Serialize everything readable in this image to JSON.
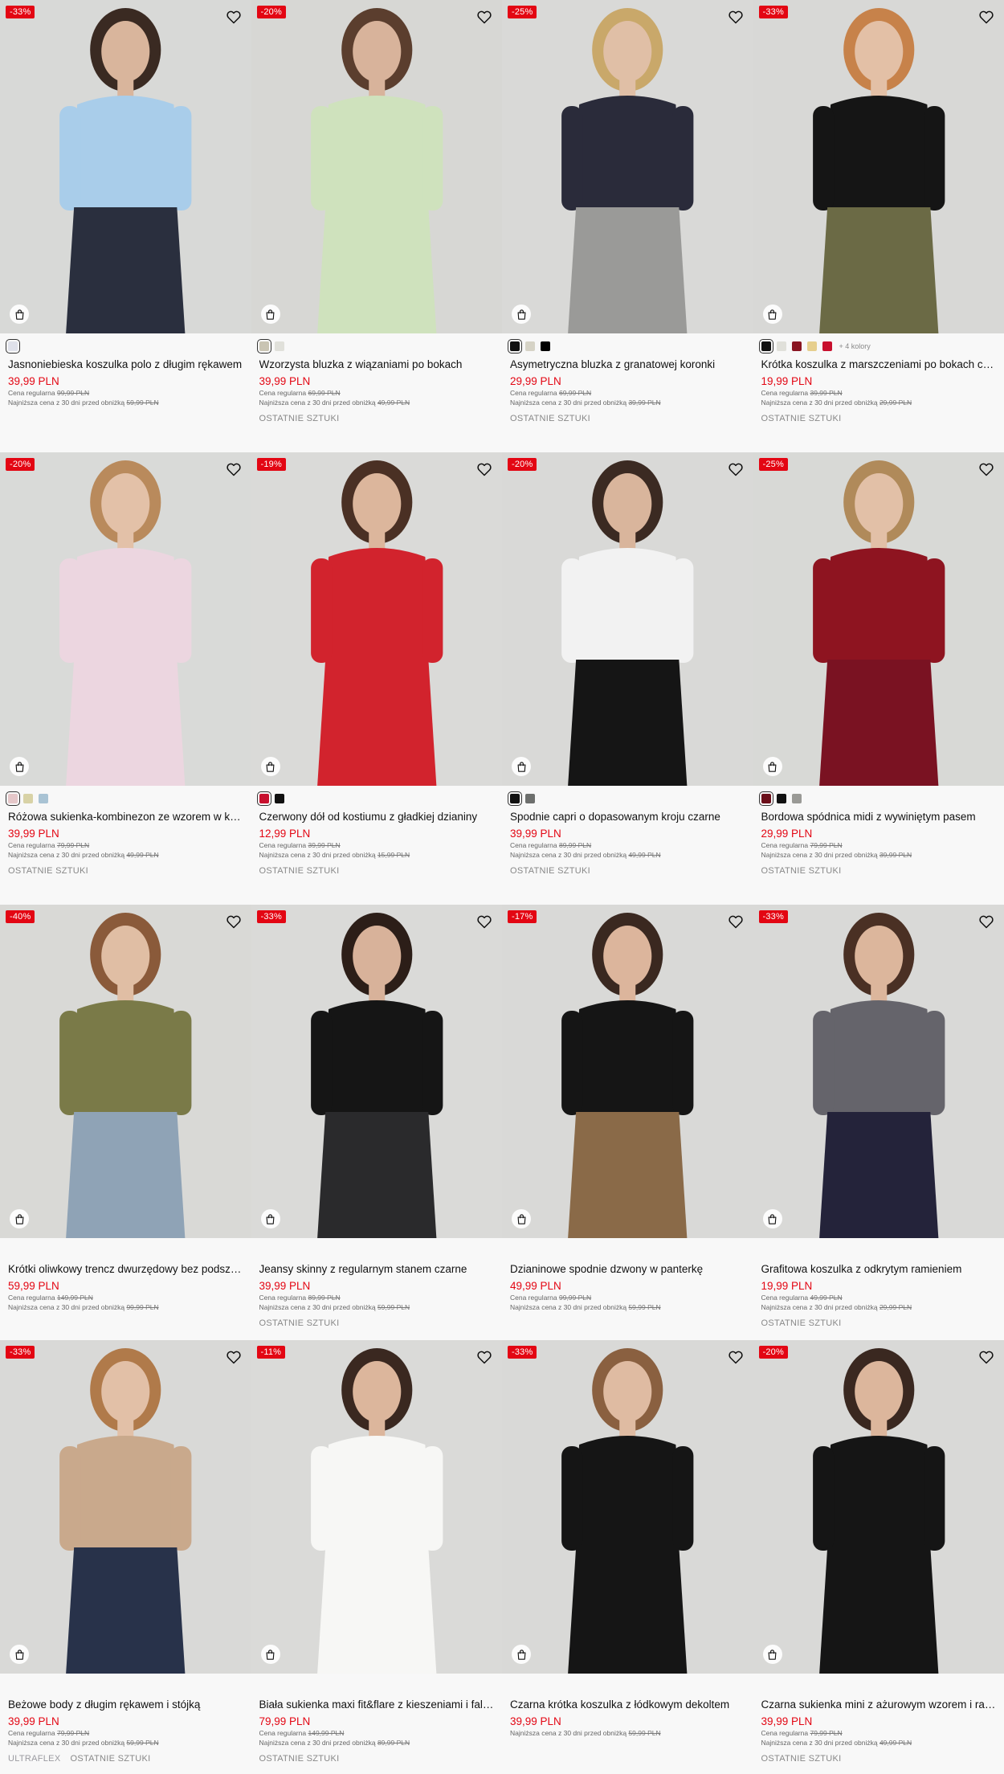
{
  "labels": {
    "regular_price": "Cena regularna",
    "lowest_30": "Najniższa cena z 30 dni przed obniżką"
  },
  "products": [
    {
      "discount": "-33%",
      "swatches": [
        "#dfe1ea"
      ],
      "selected": 0,
      "more_colors": "",
      "title": "Jasnoniebieska koszulka polo z długim rękawem",
      "price": "39,99 PLN",
      "regular": "99,99 PLN",
      "lowest": "59,99 PLN",
      "tags": [],
      "scene": {
        "bg": "#d8d9d7",
        "top": "#a9cdea",
        "bottom": "#2a2f3e",
        "hair": "#3a2a22",
        "skin": "#d9b59c"
      }
    },
    {
      "discount": "-20%",
      "swatches": [
        "#c9c4b3",
        "#e0e0da"
      ],
      "selected": 0,
      "more_colors": "",
      "title": "Wzorzysta bluzka z wiązaniami po bokach",
      "price": "39,99 PLN",
      "regular": "69,99 PLN",
      "lowest": "49,99 PLN",
      "tags": [
        "OSTATNIE SZTUKI"
      ],
      "scene": {
        "bg": "#d7d7d4",
        "top": "#cfe2bd",
        "bottom": "#cfe2bd",
        "hair": "#5b3e2e",
        "skin": "#d8b39b"
      }
    },
    {
      "discount": "-25%",
      "swatches": [
        "#111111",
        "#d6d3c6",
        "#000000"
      ],
      "selected": 0,
      "more_colors": "",
      "title": "Asymetryczna bluzka z granatowej koronki",
      "price": "29,99 PLN",
      "regular": "69,99 PLN",
      "lowest": "39,99 PLN",
      "tags": [
        "OSTATNIE SZTUKI"
      ],
      "scene": {
        "bg": "#d9d9d7",
        "top": "#2a2b3a",
        "bottom": "#9a9a98",
        "hair": "#c9a86a",
        "skin": "#e0bfa6"
      }
    },
    {
      "discount": "-33%",
      "swatches": [
        "#111111",
        "#e0e0da",
        "#8a1522",
        "#e6cf8e",
        "#c8102e"
      ],
      "selected": 0,
      "more_colors": "+ 4 kolory",
      "title": "Krótka koszulka z marszczeniami po bokach czarna",
      "price": "19,99 PLN",
      "regular": "39,99 PLN",
      "lowest": "29,99 PLN",
      "tags": [
        "OSTATNIE SZTUKI"
      ],
      "scene": {
        "bg": "#d8d8d6",
        "top": "#151515",
        "bottom": "#6b6a45",
        "hair": "#c7824a",
        "skin": "#e3c0a6"
      }
    },
    {
      "discount": "-20%",
      "swatches": [
        "#e5c7c9",
        "#d8d2a6",
        "#a9c3d4"
      ],
      "selected": 0,
      "more_colors": "",
      "title": "Różowa sukienka-kombinezon ze wzorem w kwiaty",
      "price": "39,99 PLN",
      "regular": "79,99 PLN",
      "lowest": "49,99 PLN",
      "tags": [
        "OSTATNIE SZTUKI"
      ],
      "scene": {
        "bg": "#d9dad8",
        "top": "#ecd6e0",
        "bottom": "#ecd6e0",
        "hair": "#b98a5c",
        "skin": "#e3c1a8"
      }
    },
    {
      "discount": "-19%",
      "swatches": [
        "#c8102e",
        "#111111"
      ],
      "selected": 0,
      "more_colors": "",
      "title": "Czerwony dół od kostiumu z gładkiej dzianiny",
      "price": "12,99 PLN",
      "regular": "39,99 PLN",
      "lowest": "15,99 PLN",
      "tags": [
        "OSTATNIE SZTUKI"
      ],
      "scene": {
        "bg": "#dadad8",
        "top": "#d2232d",
        "bottom": "#d2232d",
        "hair": "#4a3024",
        "skin": "#dcb69c"
      }
    },
    {
      "discount": "-20%",
      "swatches": [
        "#111111",
        "#6d6f6d"
      ],
      "selected": 0,
      "more_colors": "",
      "title": "Spodnie capri o dopasowanym kroju czarne",
      "price": "39,99 PLN",
      "regular": "89,99 PLN",
      "lowest": "49,99 PLN",
      "tags": [
        "OSTATNIE SZTUKI"
      ],
      "scene": {
        "bg": "#d9d9d7",
        "top": "#f2f2f2",
        "bottom": "#151515",
        "hair": "#3b2a22",
        "skin": "#d9b59c"
      }
    },
    {
      "discount": "-25%",
      "swatches": [
        "#6b0f1a",
        "#111111",
        "#9a9a96"
      ],
      "selected": 0,
      "more_colors": "",
      "title": "Bordowa spódnica midi z wywiniętym pasem",
      "price": "29,99 PLN",
      "regular": "79,99 PLN",
      "lowest": "39,99 PLN",
      "tags": [
        "OSTATNIE SZTUKI"
      ],
      "scene": {
        "bg": "#d8d9d6",
        "top": "#8e1420",
        "bottom": "#7a1222",
        "hair": "#b08a5a",
        "skin": "#e2c0a7"
      }
    },
    {
      "discount": "-40%",
      "swatches": [],
      "selected": -1,
      "more_colors": "",
      "title": "Krótki oliwkowy trencz dwurzędowy bez podszewki",
      "price": "59,99 PLN",
      "regular": "149,99 PLN",
      "lowest": "99,99 PLN",
      "tags": [],
      "scene": {
        "bg": "#d9d9d6",
        "top": "#7a7a48",
        "bottom": "#8fa3b6",
        "hair": "#8a5a3a",
        "skin": "#e0bea4"
      }
    },
    {
      "discount": "-33%",
      "swatches": [],
      "selected": -1,
      "more_colors": "",
      "title": "Jeansy skinny z regularnym stanem czarne",
      "price": "39,99 PLN",
      "regular": "89,99 PLN",
      "lowest": "59,99 PLN",
      "tags": [
        "OSTATNIE SZTUKI"
      ],
      "scene": {
        "bg": "#dadad8",
        "top": "#151515",
        "bottom": "#2a2a2c",
        "hair": "#2c1e18",
        "skin": "#d8b29a"
      }
    },
    {
      "discount": "-17%",
      "swatches": [],
      "selected": -1,
      "more_colors": "",
      "title": "Dzianinowe spodnie dzwony w panterkę",
      "price": "49,99 PLN",
      "regular": "99,99 PLN",
      "lowest": "59,99 PLN",
      "tags": [],
      "scene": {
        "bg": "#d9d9d7",
        "top": "#151515",
        "bottom": "#8a6a48",
        "hair": "#3a2820",
        "skin": "#dcb59c"
      }
    },
    {
      "discount": "-33%",
      "swatches": [],
      "selected": -1,
      "more_colors": "",
      "title": "Grafitowa koszulka z odkrytym ramieniem",
      "price": "19,99 PLN",
      "regular": "49,99 PLN",
      "lowest": "29,99 PLN",
      "tags": [
        "OSTATNIE SZTUKI"
      ],
      "scene": {
        "bg": "#d9d9d7",
        "top": "#65646b",
        "bottom": "#24233a",
        "hair": "#4a3024",
        "skin": "#dcb69c"
      }
    },
    {
      "discount": "-33%",
      "swatches": [],
      "selected": -1,
      "more_colors": "",
      "title": "Beżowe body z długim rękawem i stójką",
      "price": "39,99 PLN",
      "regular": "79,99 PLN",
      "lowest": "59,99 PLN",
      "tags": [
        "ULTRAFLEX",
        "OSTATNIE SZTUKI"
      ],
      "scene": {
        "bg": "#d9d9d7",
        "top": "#c9a98c",
        "bottom": "#28324a",
        "hair": "#b07a4a",
        "skin": "#e2c0a7"
      }
    },
    {
      "discount": "-11%",
      "swatches": [],
      "selected": -1,
      "more_colors": "",
      "title": "Biała sukienka maxi fit&flare z kieszeniami i falbaną",
      "price": "79,99 PLN",
      "regular": "149,99 PLN",
      "lowest": "89,99 PLN",
      "tags": [
        "OSTATNIE SZTUKI"
      ],
      "scene": {
        "bg": "#dadad8",
        "top": "#f7f7f5",
        "bottom": "#f7f7f5",
        "hair": "#3a2820",
        "skin": "#dcb69c"
      }
    },
    {
      "discount": "-33%",
      "swatches": [],
      "selected": -1,
      "more_colors": "",
      "title": "Czarna krótka koszulka z łódkowym dekoltem",
      "price": "39,99 PLN",
      "regular": "",
      "lowest": "59,99 PLN",
      "tags": [],
      "scene": {
        "bg": "#d9d9d7",
        "top": "#151515",
        "bottom": "#151515",
        "hair": "#8a6040",
        "skin": "#dfbba2"
      }
    },
    {
      "discount": "-20%",
      "swatches": [],
      "selected": -1,
      "more_colors": "",
      "title": "Czarna sukienka mini z ażurowym wzorem i ramiączkami",
      "price": "39,99 PLN",
      "regular": "79,99 PLN",
      "lowest": "49,99 PLN",
      "tags": [
        "OSTATNIE SZTUKI"
      ],
      "scene": {
        "bg": "#d9d9d7",
        "top": "#151515",
        "bottom": "#151515",
        "hair": "#3a2820",
        "skin": "#dcb69c"
      }
    }
  ]
}
